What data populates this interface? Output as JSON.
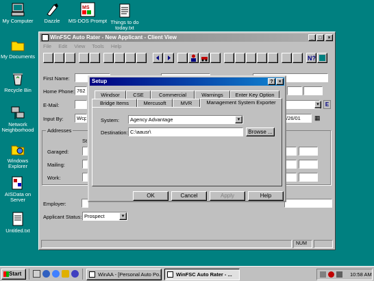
{
  "desktop": {
    "icons": [
      {
        "label": "My Computer"
      },
      {
        "label": "Dazzle"
      },
      {
        "label": "MS-DOS Prompt"
      },
      {
        "label": "Things to do today.txt"
      },
      {
        "label": "My Documents"
      },
      {
        "label": "Recycle Bin"
      },
      {
        "label": "Network Neighborhood"
      },
      {
        "label": "Windows Explorer"
      },
      {
        "label": "AISData on Server"
      },
      {
        "label": "Untitled.txt"
      }
    ]
  },
  "app_window": {
    "title": "WinFSC Auto Rater - New Applicant - Client View",
    "menu": [
      "File",
      "Edit",
      "View",
      "Tools",
      "Help"
    ],
    "labels": {
      "first_name": "First Name:",
      "home_phone": "Home Phone:",
      "home_phone_value": "762",
      "email": "E-Mail:",
      "email_btn": "E",
      "input_by": "Input By:",
      "input_by_value": "Wcp",
      "date_value": "/26/01",
      "addresses": "Addresses",
      "street": "St",
      "garaged": "Garaged:",
      "mailing": "Mailing:",
      "work": "Work:",
      "employer": "Employer:",
      "applicant_status": "Applicant Status:",
      "applicant_status_value": "Prospect"
    },
    "status_bar": {
      "num": "NUM"
    }
  },
  "setup_dialog": {
    "title": "Setup",
    "tabs_row1": [
      "Windsor",
      "CSE",
      "Commercial",
      "Warnings",
      "Enter Key Option"
    ],
    "tabs_row2": [
      "Bridge Items",
      "Mercusoft",
      "MVR",
      "Management System Exporter"
    ],
    "system_label": "System:",
    "system_value": "Agency Advantage",
    "destination_label": "Destination:",
    "destination_value": "C:\\aausr\\",
    "browse_label": "Browse ...",
    "ok_label": "OK",
    "cancel_label": "Cancel",
    "apply_label": "Apply",
    "help_label": "Help"
  },
  "taskbar": {
    "start_label": "Start",
    "tasks": [
      "WinAA - [Personal Auto Po...",
      "WinFSC Auto Rater - ..."
    ],
    "clock": "10:58 AM"
  }
}
